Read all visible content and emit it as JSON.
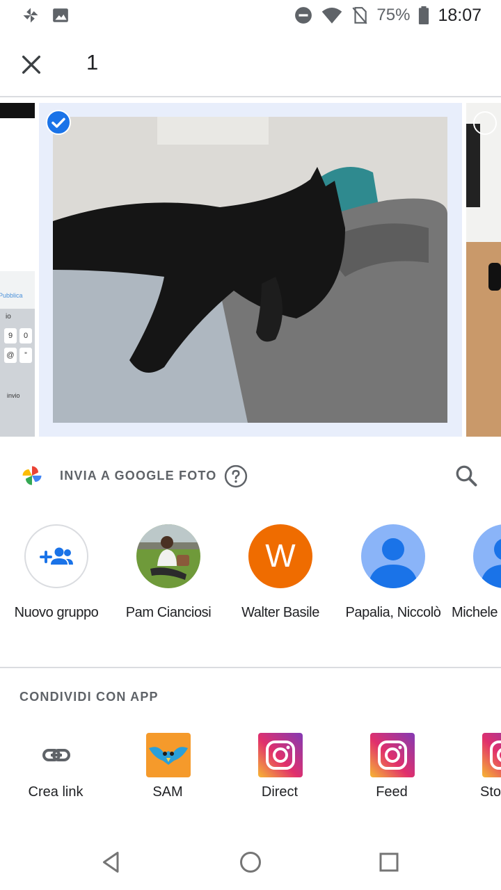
{
  "status_bar": {
    "battery": "75%",
    "time": "18:07"
  },
  "header": {
    "selected_count": "1"
  },
  "photo_strip": {
    "left_thumb_keys": [
      "9",
      "0",
      "@",
      "”"
    ],
    "left_thumb_texts": [
      "Pubblica",
      "io",
      "invio"
    ]
  },
  "google_photos": {
    "label": "INVIA A GOOGLE FOTO"
  },
  "contacts": [
    {
      "name": "Nuovo gruppo"
    },
    {
      "name": "Pam Cianciosi"
    },
    {
      "name": "Walter Basile",
      "initial": "W",
      "color": "#ef6c00"
    },
    {
      "name": "Papalia, Niccolò"
    },
    {
      "name": "Michele"
    }
  ],
  "apps_section": {
    "title": "CONDIVIDI CON APP",
    "apps": [
      {
        "label": "Crea link",
        "icon": "link-icon"
      },
      {
        "label": "SAM",
        "icon": "sam-app-icon"
      },
      {
        "label": "Direct",
        "icon": "instagram-icon"
      },
      {
        "label": "Feed",
        "icon": "instagram-icon"
      },
      {
        "label": "Sto",
        "icon": "instagram-icon"
      }
    ]
  },
  "colors": {
    "accent": "#1a73e8",
    "selection_bg": "#e8eefb",
    "walter_avatar": "#ef6c00",
    "default_avatar": "#8ab4f8"
  }
}
